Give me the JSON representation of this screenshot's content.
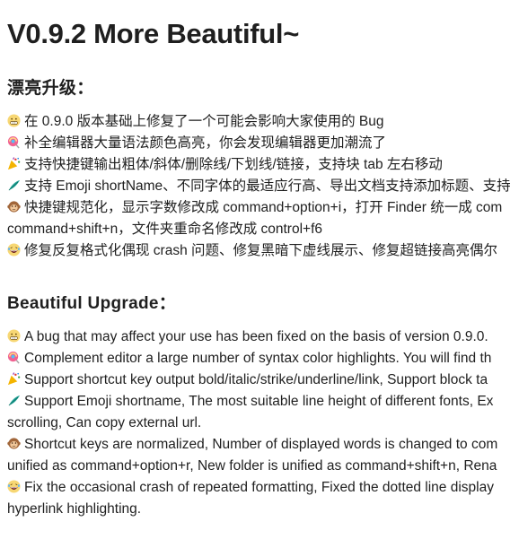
{
  "title": "V0.9.2 More Beautiful~",
  "sections": [
    {
      "heading": "漂亮升级：",
      "items": [
        {
          "icon": "grimacing-face-icon",
          "text": "在 0.9.0 版本基础上修复了一个可能会影响大家使用的 Bug",
          "cont": ""
        },
        {
          "icon": "lollipop-icon",
          "text": "补全编辑器大量语法颜色高亮，你会发现编辑器更加潮流了",
          "cont": ""
        },
        {
          "icon": "party-popper-icon",
          "text": "支持快捷键输出粗体/斜体/删除线/下划线/链接，支持块 tab 左右移动",
          "cont": ""
        },
        {
          "icon": "feather-icon",
          "text": "支持 Emoji shortName、不同字体的最适应行高、导出文档支持添加标题、支持",
          "cont": ""
        },
        {
          "icon": "monkey-face-icon",
          "text": "快捷键规范化，显示字数修改成 command+option+i，打开 Finder 统一成 com",
          "cont": "command+shift+n，文件夹重命名修改成 control+f6"
        },
        {
          "icon": "laughing-face-icon",
          "text": "修复反复格式化偶现 crash 问题、修复黑暗下虚线展示、修复超链接高亮偶尔",
          "cont": ""
        }
      ]
    },
    {
      "heading": "Beautiful Upgrade：",
      "items": [
        {
          "icon": "grimacing-face-icon",
          "text": "A bug that may affect your use has been fixed on the basis of version 0.9.0.",
          "cont": ""
        },
        {
          "icon": "lollipop-icon",
          "text": "Complement editor a large number of syntax color highlights. You will find th",
          "cont": ""
        },
        {
          "icon": "party-popper-icon",
          "text": "Support shortcut key output bold/italic/strike/underline/link, Support block ta",
          "cont": ""
        },
        {
          "icon": "feather-icon",
          "text": "Support Emoji shortname, The most suitable line height of different fonts, Ex",
          "cont": "scrolling, Can copy external url."
        },
        {
          "icon": "monkey-face-icon",
          "text": "Shortcut keys are normalized, Number of displayed words is changed to com",
          "cont": "unified as command+option+r, New folder is unified as command+shift+n, Rena"
        },
        {
          "icon": "laughing-face-icon",
          "text": "Fix the occasional crash of repeated formatting, Fixed the dotted line display",
          "cont": "hyperlink highlighting."
        }
      ]
    }
  ]
}
